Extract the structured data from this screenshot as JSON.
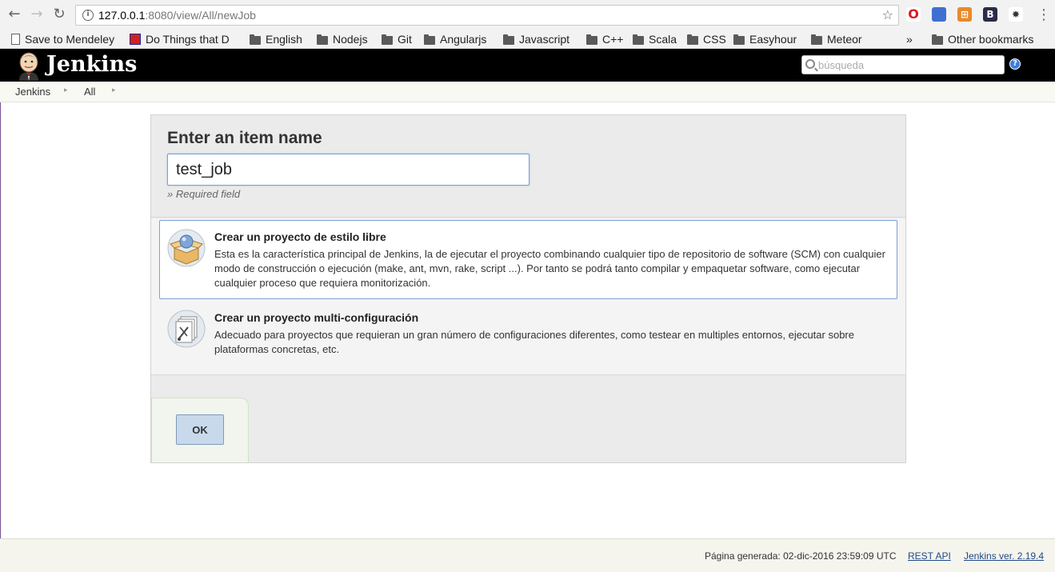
{
  "browser": {
    "url_host": "127.0.0.1",
    "url_path": ":8080/view/All/newJob",
    "bookmarks": [
      {
        "label": "Save to Mendeley",
        "type": "page"
      },
      {
        "label": "Do Things that D",
        "type": "flag"
      },
      {
        "label": "English",
        "type": "folder"
      },
      {
        "label": "Nodejs",
        "type": "folder"
      },
      {
        "label": "Git",
        "type": "folder"
      },
      {
        "label": "Angularjs",
        "type": "folder"
      },
      {
        "label": "Javascript",
        "type": "folder"
      },
      {
        "label": "C++",
        "type": "folder"
      },
      {
        "label": "Scala",
        "type": "folder"
      },
      {
        "label": "CSS",
        "type": "folder"
      },
      {
        "label": "Easyhour",
        "type": "folder"
      },
      {
        "label": "Meteor",
        "type": "folder"
      }
    ],
    "overflow": "»",
    "other_bookmarks": "Other bookmarks"
  },
  "jenkins": {
    "title": "Jenkins",
    "search_placeholder": "búsqueda",
    "help": "?",
    "breadcrumbs": [
      "Jenkins",
      "All"
    ]
  },
  "form": {
    "heading": "Enter an item name",
    "item_name": "test_job",
    "required_hint": "» Required field",
    "item_types": [
      {
        "label": "Crear un proyecto de estilo libre",
        "description": "Esta es la característica principal de Jenkins, la de ejecutar el proyecto combinando cualquier tipo de repositorio de software (SCM) con cualquier modo de construcción o ejecución (make, ant, mvn, rake, script ...). Por tanto se podrá tanto compilar y empaquetar software, como ejecutar cualquier proceso que requiera monitorización.",
        "icon": "freestyle-box-icon",
        "selected": true
      },
      {
        "label": "Crear un proyecto multi-configuración",
        "description": "Adecuado para proyectos que requieran un gran número de configuraciones diferentes, como testear en multiples entornos, ejecutar sobre plataformas concretas, etc.",
        "icon": "multi-config-icon",
        "selected": false
      }
    ],
    "ok_label": "OK"
  },
  "footer": {
    "generated": "Página generada: 02-dic-2016 23:59:09 UTC",
    "rest_api": "REST API",
    "version": "Jenkins ver. 2.19.4"
  }
}
